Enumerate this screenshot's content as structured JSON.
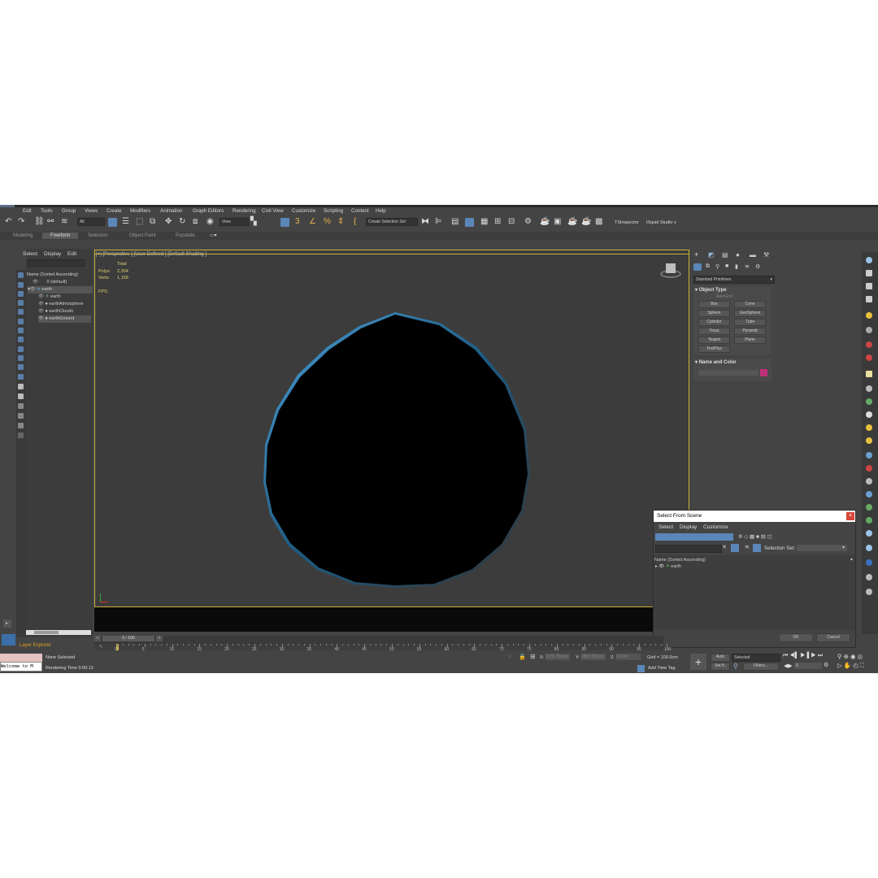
{
  "menu": [
    "Edit",
    "Tools",
    "Group",
    "Views",
    "Create",
    "Modifiers",
    "Animation",
    "Graph Editors",
    "Rendering",
    "Civil View",
    "Customize",
    "Scripting",
    "Content",
    "Help"
  ],
  "toolbar": {
    "filter_value": "All",
    "view_value": "View",
    "selection_set": "Create Selection Set",
    "ts_inspector": "TSInspector",
    "isquid": "iSquid Studio v"
  },
  "ribbon_tabs": [
    "Modeling",
    "Freeform",
    "Selection",
    "Object Paint",
    "Populate"
  ],
  "scene_explorer": {
    "menus": [
      "Select",
      "Display",
      "Edit"
    ],
    "header": "Name (Sorted Ascending)",
    "rows": [
      "0 (default)",
      "earth",
      "earth",
      "earthAtmosphere",
      "earthClouds",
      "earthGround"
    ],
    "footer_label": "Layer Explorer"
  },
  "viewport": {
    "label": "[+] [Perspective ] [User Defined ] [Default Shading ]",
    "stats_total": "Total",
    "polys_label": "Polys:",
    "polys_value": "2,304",
    "verts_label": "Verts:",
    "verts_value": "1,158",
    "fps_label": "FPS:"
  },
  "command_panel": {
    "category": "Standard Primitives",
    "object_type_header": "Object Type",
    "autogrid": "AutoGrid",
    "buttons": [
      "Box",
      "Cone",
      "Sphere",
      "GeoSphere",
      "Cylinder",
      "Tube",
      "Torus",
      "Pyramid",
      "Teapot",
      "Plane",
      "TextPlus"
    ],
    "name_color_header": "Name and Color",
    "swatch_color": "#c0307a"
  },
  "dialog": {
    "title": "Select From Scene",
    "menus": [
      "Select",
      "Display",
      "Customize"
    ],
    "selection_set_label": "Selection Set:",
    "list_header": "Name (Sorted Ascending)",
    "items": [
      "earth"
    ],
    "ok": "OK",
    "cancel": "Cancel"
  },
  "timeline": {
    "frame_display": "0 / 100",
    "ticks": [
      "0",
      "5",
      "10",
      "15",
      "20",
      "25",
      "30",
      "35",
      "40",
      "45",
      "50",
      "55",
      "60",
      "65",
      "70",
      "75",
      "80",
      "85",
      "90",
      "95",
      "100"
    ]
  },
  "status": {
    "maxscript": "Welcome to M",
    "selection": "None Selected",
    "render_time": "Rendering Time  0:00:13",
    "x_label": "X:",
    "x_value": "1376.753cm",
    "y_label": "Y:",
    "y_value": "2852.055cm",
    "z_label": "Z:",
    "z_value": "0.0cm",
    "grid": "Grid = 100.0cm",
    "add_time_tag": "Add Time Tag",
    "auto": "Auto",
    "set_key": "Set K.",
    "key_mode": "Selected",
    "filters": "Filters...",
    "frame": "0"
  }
}
